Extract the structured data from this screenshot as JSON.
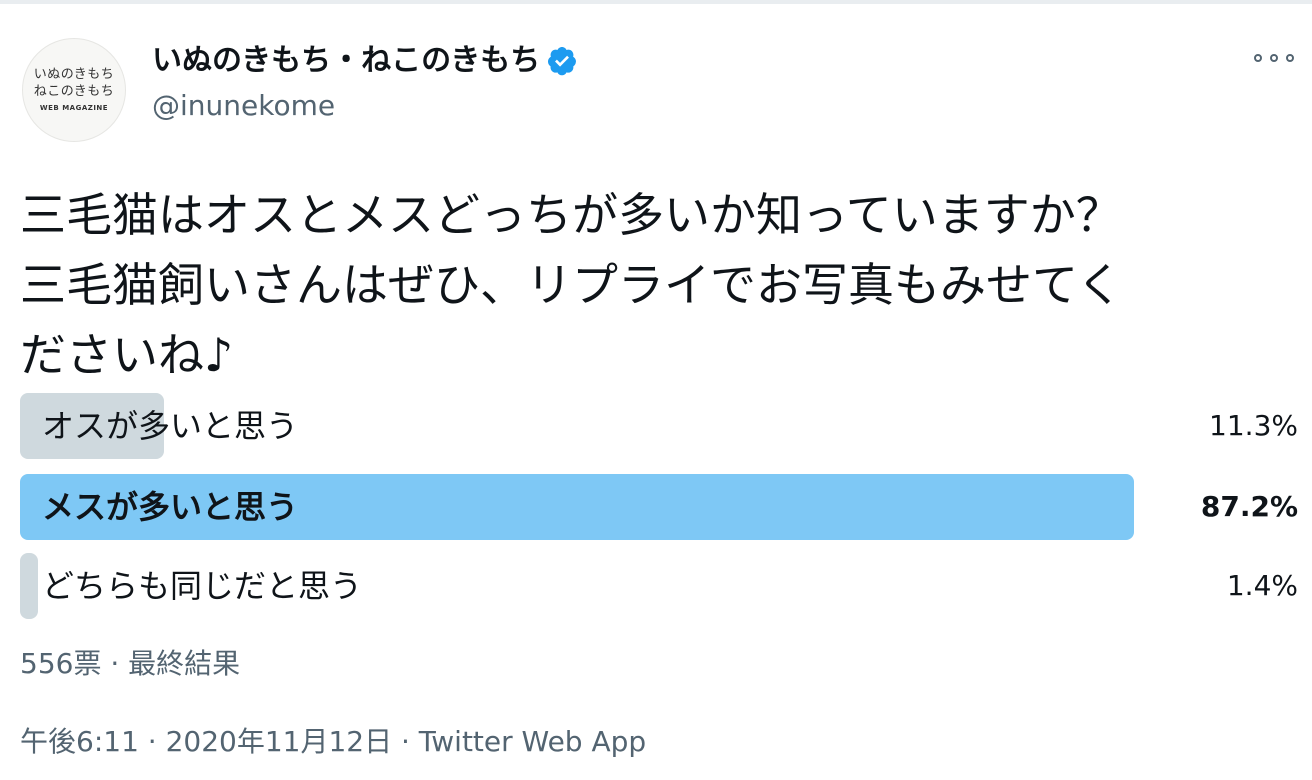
{
  "account": {
    "display_name": "いぬのきもち・ねこのきもち",
    "handle": "@inunekome",
    "avatar_logo_line1": "いぬのきもち",
    "avatar_logo_line2": "ねこのきもち",
    "avatar_logo_sub": "WEB MAGAZINE",
    "verified_icon": "verified-badge-icon",
    "verified_color": "#1d9bf0"
  },
  "more_icon": "more-options-icon",
  "tweet": {
    "line1": "三毛猫はオスとメスどっちが多いか知っていますか？",
    "line2": "三毛猫飼いさんはぜひ、リプライでお写真もみせてく",
    "line3": "ださいね♪"
  },
  "poll": {
    "options": [
      {
        "label": "オスが多いと思う",
        "percent_text": "11.3%",
        "percent": 11.3,
        "winner": false
      },
      {
        "label": "メスが多いと思う",
        "percent_text": "87.2%",
        "percent": 87.2,
        "winner": true
      },
      {
        "label": "どちらも同じだと思う",
        "percent_text": "1.4%",
        "percent": 1.4,
        "winner": false
      }
    ],
    "votes_text": "556票 · 最終結果",
    "colors": {
      "winner_bar": "#7ec8f5",
      "loser_bar": "#cfd9de"
    }
  },
  "meta": {
    "timestamp": "午後6:11 · 2020年11月12日 · Twitter Web App"
  }
}
